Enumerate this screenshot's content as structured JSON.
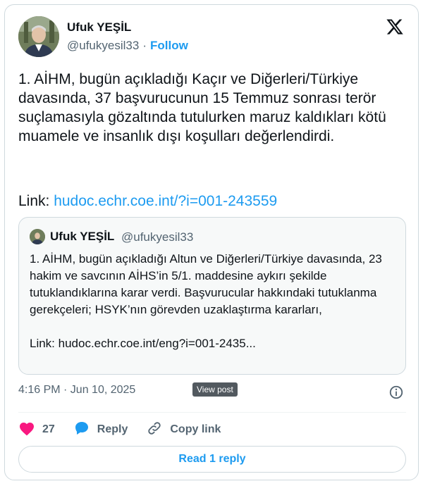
{
  "author": {
    "name": "Ufuk YEŞİL",
    "handle": "@ufukyesil33",
    "separator": "·",
    "follow_label": "Follow"
  },
  "tweet": {
    "text": "1. AİHM, bugün açıkladığı Kaçır ve Diğerleri/Türkiye davasında, 37 başvurucunun 15 Temmuz sonrası terör suçlamasıyla gözaltında tutulurken maruz kaldıkları kötü muamele ve insanlık dışı koşulları değerlendirdi.",
    "link_prefix": "Link: ",
    "link_text": "hudoc.echr.coe.int/?i=001-243559"
  },
  "quote": {
    "name": "Ufuk YEŞİL",
    "handle": "@ufukyesil33",
    "text": "1. AİHM, bugün açıkladığı Altun ve Diğerleri/Türkiye davasında, 23 hakim ve savcının AİHS’in 5/1. maddesine aykırı şekilde tutuklandıklarına karar verdi. Başvurucular hakkındaki tutuklanma gerekçeleri; HSYK’nın görevden uzaklaştırma kararları,\n\nLink: hudoc.echr.coe.int/eng?i=001-2435..."
  },
  "meta": {
    "timestamp": "4:16 PM · Jun 10, 2025",
    "tooltip": "View post"
  },
  "actions": {
    "like_count": "27",
    "reply_label": "Reply",
    "copy_label": "Copy link"
  },
  "read_reply_label": "Read 1 reply",
  "colors": {
    "accent": "#1d9bf0",
    "heart": "#f91880",
    "muted": "#536471",
    "border": "#cfd9de"
  },
  "icons": [
    "x-logo-icon",
    "heart-icon",
    "reply-bubble-icon",
    "link-icon",
    "info-icon"
  ]
}
